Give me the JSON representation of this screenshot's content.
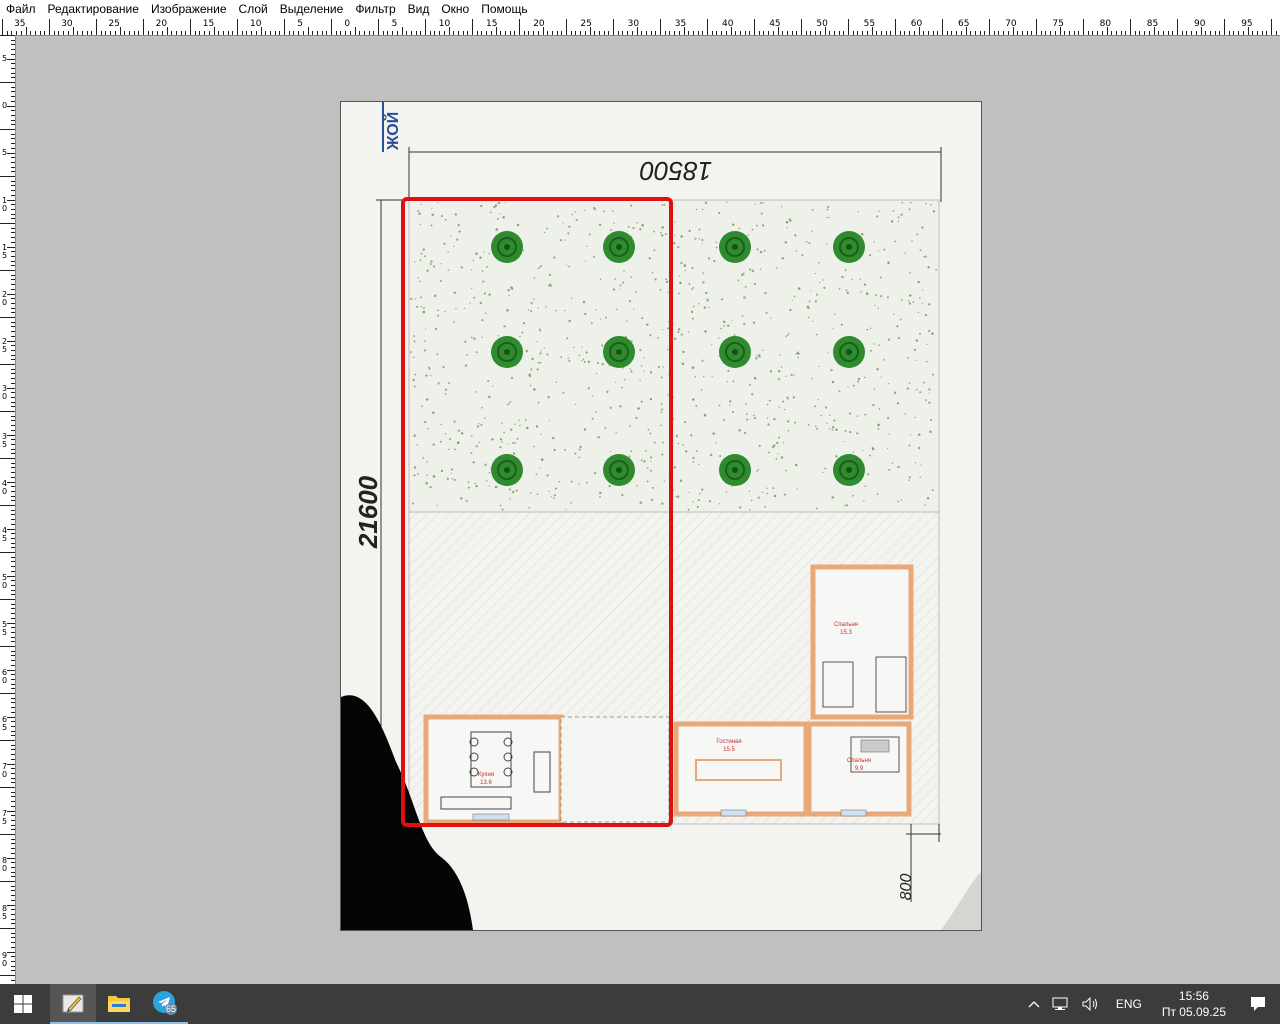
{
  "menu": [
    "Файл",
    "Редактирование",
    "Изображение",
    "Слой",
    "Выделение",
    "Фильтр",
    "Вид",
    "Окно",
    "Помощь"
  ],
  "hruler_labels": [
    "35",
    "30",
    "25",
    "20",
    "15",
    "10",
    "5",
    "0",
    "5",
    "10",
    "15",
    "20",
    "25",
    "30",
    "35",
    "40",
    "45",
    "50",
    "55",
    "60",
    "65",
    "70",
    "75",
    "80",
    "85",
    "90",
    "95"
  ],
  "vruler_labels": [
    "5",
    "0",
    "5",
    "10",
    "15",
    "20",
    "25",
    "30",
    "35",
    "40",
    "45",
    "50",
    "55",
    "60",
    "65",
    "70",
    "75",
    "80",
    "85",
    "90"
  ],
  "drawing": {
    "side_text": "ЖОЙ",
    "dim_width": "18500",
    "dim_height": "21600",
    "dim_offset": "800",
    "room_kitchen": "Кухня",
    "room_kitchen_area": "13.6",
    "room_living": "Гостиная",
    "room_living_area": "15.5",
    "room_bed1": "Спальня",
    "room_bed1_area": "15.3",
    "room_bed2": "Спальня",
    "room_bed2_area": "9.9"
  },
  "colors": {
    "selection": "#e01010",
    "tree": "#2e8b2e",
    "wall": "#e8a878",
    "room_label": "#c0302a"
  },
  "taskbar": {
    "apps": [
      "start-icon",
      "paint-app-icon",
      "file-explorer-icon",
      "telegram-icon"
    ],
    "telegram_badge": "65",
    "language": "ENG",
    "time": "15:56",
    "date": "Пт 05.09.25"
  }
}
